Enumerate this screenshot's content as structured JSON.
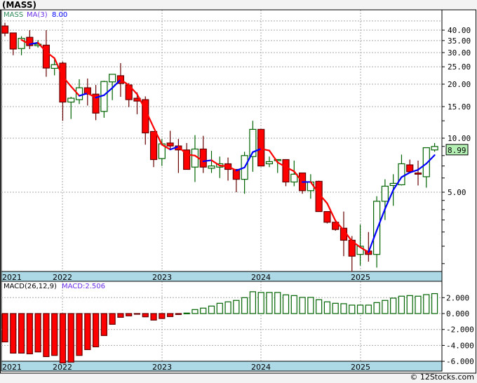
{
  "title": "(MASS)",
  "footer": "© 12Stocks.com",
  "price_panel": {
    "legend_symbol": "MASS",
    "legend_ma": "MA(3)",
    "legend_ma_value": "8.00",
    "last_price_label": "8.99"
  },
  "macd_panel": {
    "legend_name": "MACD(26,12,9)",
    "legend_value": "MACD:2.506"
  },
  "colors": {
    "up": "#006400",
    "down": "#ff0000",
    "ma_up": "#0000ff",
    "ma_down": "#ff0000",
    "axis_band": "#add8e6",
    "price_label_bg": "#b4f0b4"
  },
  "chart_data": [
    {
      "type": "candlestick",
      "title": "(MASS)",
      "interval": "monthly",
      "yscale": "log",
      "ylim": [
        1.7,
        50
      ],
      "y_ticks": [
        "40.00",
        "35.00",
        "30.00",
        "25.00",
        "20.00",
        "15.00",
        "10.00",
        "5.00"
      ],
      "x_labels": [
        "2021",
        "2022",
        "2023",
        "2024",
        "2025"
      ],
      "grid": true,
      "ma_period": 3,
      "ohlc": [
        [
          42.2,
          44,
          37,
          38.5
        ],
        [
          38.6,
          38.6,
          29,
          31.4
        ],
        [
          31.6,
          37,
          29,
          36
        ],
        [
          36.5,
          40,
          31.4,
          32.8
        ],
        [
          32.8,
          35.2,
          32,
          33.4
        ],
        [
          33,
          40,
          22,
          24.6
        ],
        [
          24.5,
          28,
          22.4,
          25.7
        ],
        [
          26.2,
          26.7,
          12.5,
          15.9
        ],
        [
          15.9,
          17,
          12.8,
          16.7
        ],
        [
          16.4,
          21.3,
          15.5,
          19.1
        ],
        [
          19.1,
          21.5,
          15.2,
          17.6
        ],
        [
          17.6,
          19.8,
          12.6,
          13.8
        ],
        [
          14.1,
          20.9,
          13,
          20.7
        ],
        [
          20.6,
          22.7,
          16.3,
          22.7
        ],
        [
          22.3,
          26.2,
          17,
          20.2
        ],
        [
          19.8,
          20.3,
          14.9,
          16.4
        ],
        [
          16.7,
          18,
          13.6,
          16.1
        ],
        [
          16.4,
          17.1,
          9.2,
          10.7
        ],
        [
          10.9,
          10.9,
          6.9,
          7.6
        ],
        [
          7.7,
          9.9,
          7.0,
          9.3
        ],
        [
          9.4,
          11,
          8.6,
          9.05
        ],
        [
          9.05,
          9.9,
          6.4,
          8.6
        ],
        [
          8.6,
          9.4,
          6.7,
          6.7
        ],
        [
          6.9,
          10.4,
          5.7,
          8.7
        ],
        [
          8.7,
          10.3,
          6.4,
          6.9
        ],
        [
          6.8,
          8.5,
          6.4,
          7.0
        ],
        [
          6.9,
          7.9,
          6.0,
          7.2
        ],
        [
          7.2,
          7.8,
          5.8,
          6.7
        ],
        [
          6.7,
          6.7,
          5.0,
          5.9
        ],
        [
          5.9,
          8.4,
          4.9,
          8.0
        ],
        [
          7.9,
          12.5,
          6.5,
          11.2
        ],
        [
          11.2,
          11.2,
          6.95,
          7.0
        ],
        [
          7.2,
          7.9,
          6.9,
          7.4
        ],
        [
          7.5,
          7.6,
          6.4,
          7.6
        ],
        [
          7.6,
          7.6,
          5.4,
          5.7
        ],
        [
          5.7,
          7.5,
          5.4,
          6.3
        ],
        [
          6.4,
          6.4,
          4.9,
          5.1
        ],
        [
          5.1,
          6.3,
          4.6,
          5.7
        ],
        [
          5.75,
          5.8,
          3.9,
          3.9
        ],
        [
          3.9,
          3.9,
          3.35,
          3.4
        ],
        [
          3.4,
          3.4,
          3.05,
          3.1
        ],
        [
          3.15,
          3.9,
          2.2,
          2.7
        ],
        [
          2.7,
          2.85,
          1.8,
          2.2
        ],
        [
          2.25,
          3.3,
          1.95,
          2.5
        ],
        [
          2.35,
          3.0,
          2.05,
          2.25
        ],
        [
          2.25,
          4.75,
          1.9,
          4.45
        ],
        [
          4.45,
          5.9,
          3.5,
          5.4
        ],
        [
          5.45,
          6.3,
          4.2,
          5.6
        ],
        [
          5.5,
          8.1,
          5.45,
          7.2
        ],
        [
          7.1,
          7.6,
          6.5,
          6.5
        ],
        [
          6.4,
          7.5,
          5.45,
          6.3
        ],
        [
          6.1,
          8.85,
          5.3,
          8.85
        ],
        [
          8.6,
          9.4,
          8.4,
          8.99
        ]
      ]
    },
    {
      "type": "bar",
      "title": "MACD(26,12,9)",
      "ylim": [
        -6,
        3
      ],
      "y_ticks": [
        "2.000",
        "0.000",
        "-2.000",
        "-4.000",
        "-6.000"
      ],
      "x_labels": [
        "2021",
        "2022",
        "2023",
        "2024",
        "2025"
      ],
      "values": [
        -3.56,
        -4.97,
        -4.97,
        -5.06,
        -4.82,
        -5.41,
        -5.26,
        -6.2,
        -6.1,
        -5.26,
        -4.53,
        -4.18,
        -2.76,
        -1.35,
        -0.47,
        -0.29,
        -0.03,
        -0.41,
        -0.82,
        -0.62,
        -0.38,
        -0.12,
        0.06,
        0.5,
        0.68,
        0.94,
        1.29,
        1.47,
        1.65,
        2.0,
        2.74,
        2.65,
        2.65,
        2.65,
        2.35,
        2.26,
        2.03,
        2.03,
        1.74,
        1.47,
        1.29,
        1.24,
        1.06,
        1.06,
        1.06,
        1.38,
        1.65,
        1.94,
        2.18,
        2.26,
        2.18,
        2.38,
        2.506
      ]
    }
  ]
}
